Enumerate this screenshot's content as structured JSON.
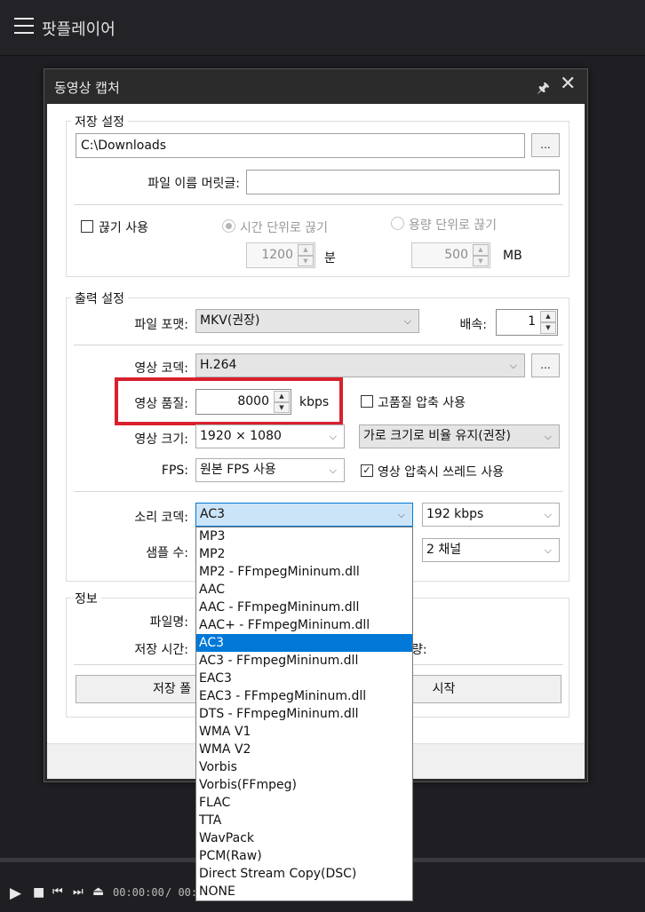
{
  "app": {
    "title": "팟플레이어"
  },
  "dialog": {
    "title": "동영상 캡처"
  },
  "save": {
    "legend": "저장 설정",
    "path": "C:\\Downloads",
    "browse_label": "...",
    "prefix_label": "파일 이름 머릿글:",
    "prefix_value": "",
    "split_label": "끊기 사용",
    "split_checked": false,
    "time_split_label": "시간 단위로 끊기",
    "size_split_label": "용량 단위로 끊기",
    "time_value": "1200",
    "time_unit": "분",
    "size_value": "500",
    "size_unit": "MB"
  },
  "output": {
    "legend": "출력 설정",
    "format_label": "파일 포맷:",
    "format_value": "MKV(권장)",
    "speed_label": "배속:",
    "speed_value": "1",
    "vcodec_label": "영상 코덱:",
    "vcodec_value": "H.264",
    "vcodec_browse": "...",
    "quality_label": "영상 품질:",
    "quality_value": "8000",
    "quality_unit": "kbps",
    "hq_label": "고품질 압축 사용",
    "hq_checked": false,
    "size_label": "영상 크기:",
    "size_value": "1920 × 1080",
    "aspect_value": "가로 크기로 비율 유지(권장)",
    "fps_label": "FPS:",
    "fps_value": "원본 FPS 사용",
    "thread_label": "영상 압축시 쓰레드 사용",
    "thread_checked": true,
    "acodec_label": "소리 코덱:",
    "acodec_value": "AC3",
    "bitrate_value": "192 kbps",
    "samples_label": "샘플 수:",
    "channels_value": "2 채널"
  },
  "info": {
    "legend": "정보",
    "filename_label": "파일명:",
    "savetime_label": "저장 시간:",
    "partial_label": "량:",
    "folder_button": "저장 폴",
    "start_button": "시작"
  },
  "acodec_options": [
    "MP3",
    "MP2",
    "MP2 - FFmpegMininum.dll",
    "AAC",
    "AAC - FFmpegMininum.dll",
    "AAC+ - FFmpegMininum.dll",
    "AC3",
    "AC3 - FFmpegMininum.dll",
    "EAC3",
    "EAC3 - FFmpegMininum.dll",
    "DTS - FFmpegMininum.dll",
    "WMA V1",
    "WMA V2",
    "Vorbis",
    "Vorbis(FFmpeg)",
    "FLAC",
    "TTA",
    "WavPack",
    "PCM(Raw)",
    "Direct Stream Copy(DSC)",
    "NONE"
  ],
  "acodec_selected": "AC3",
  "player": {
    "time_current": "00:00:00",
    "time_total": "/ 00:0"
  }
}
